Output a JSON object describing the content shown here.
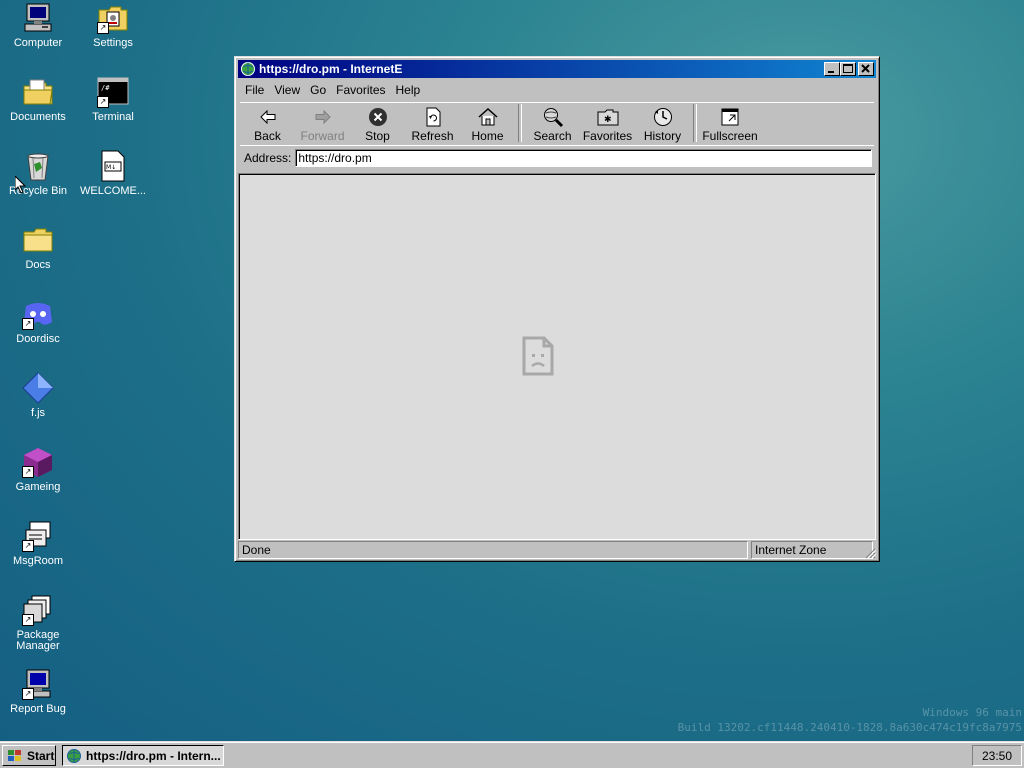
{
  "desktop": {
    "icons": [
      {
        "label": "Computer"
      },
      {
        "label": "Settings"
      },
      {
        "label": "Documents"
      },
      {
        "label": "Terminal"
      },
      {
        "label": "Recycle Bin"
      },
      {
        "label": "WELCOME..."
      },
      {
        "label": "Docs"
      },
      {
        "label": "Doordisc"
      },
      {
        "label": "f.js"
      },
      {
        "label": "Gameing"
      },
      {
        "label": "MsgRoom"
      },
      {
        "label": "Package Manager"
      },
      {
        "label": "Report Bug"
      }
    ],
    "watermark": {
      "line1": "Windows 96 main",
      "line2": "Build 13202.cf11448.240410-1828.8a630c474c19fc8a7975"
    }
  },
  "window": {
    "title": "https://dro.pm - InternetE",
    "menu": [
      "File",
      "View",
      "Go",
      "Favorites",
      "Help"
    ],
    "toolbar": {
      "back": "Back",
      "forward": "Forward",
      "stop": "Stop",
      "refresh": "Refresh",
      "home": "Home",
      "search": "Search",
      "favorites": "Favorites",
      "history": "History",
      "fullscreen": "Fullscreen"
    },
    "address": {
      "label": "Address:",
      "value": "https://dro.pm"
    },
    "status": {
      "text": "Done",
      "zone": "Internet Zone"
    }
  },
  "taskbar": {
    "start_label": "Start",
    "task_label": "https://dro.pm - Intern...",
    "clock": "23:50"
  },
  "colors": {
    "titlebar_start": "#000080",
    "titlebar_end": "#1084d0",
    "chrome": "#c0c0c0"
  }
}
